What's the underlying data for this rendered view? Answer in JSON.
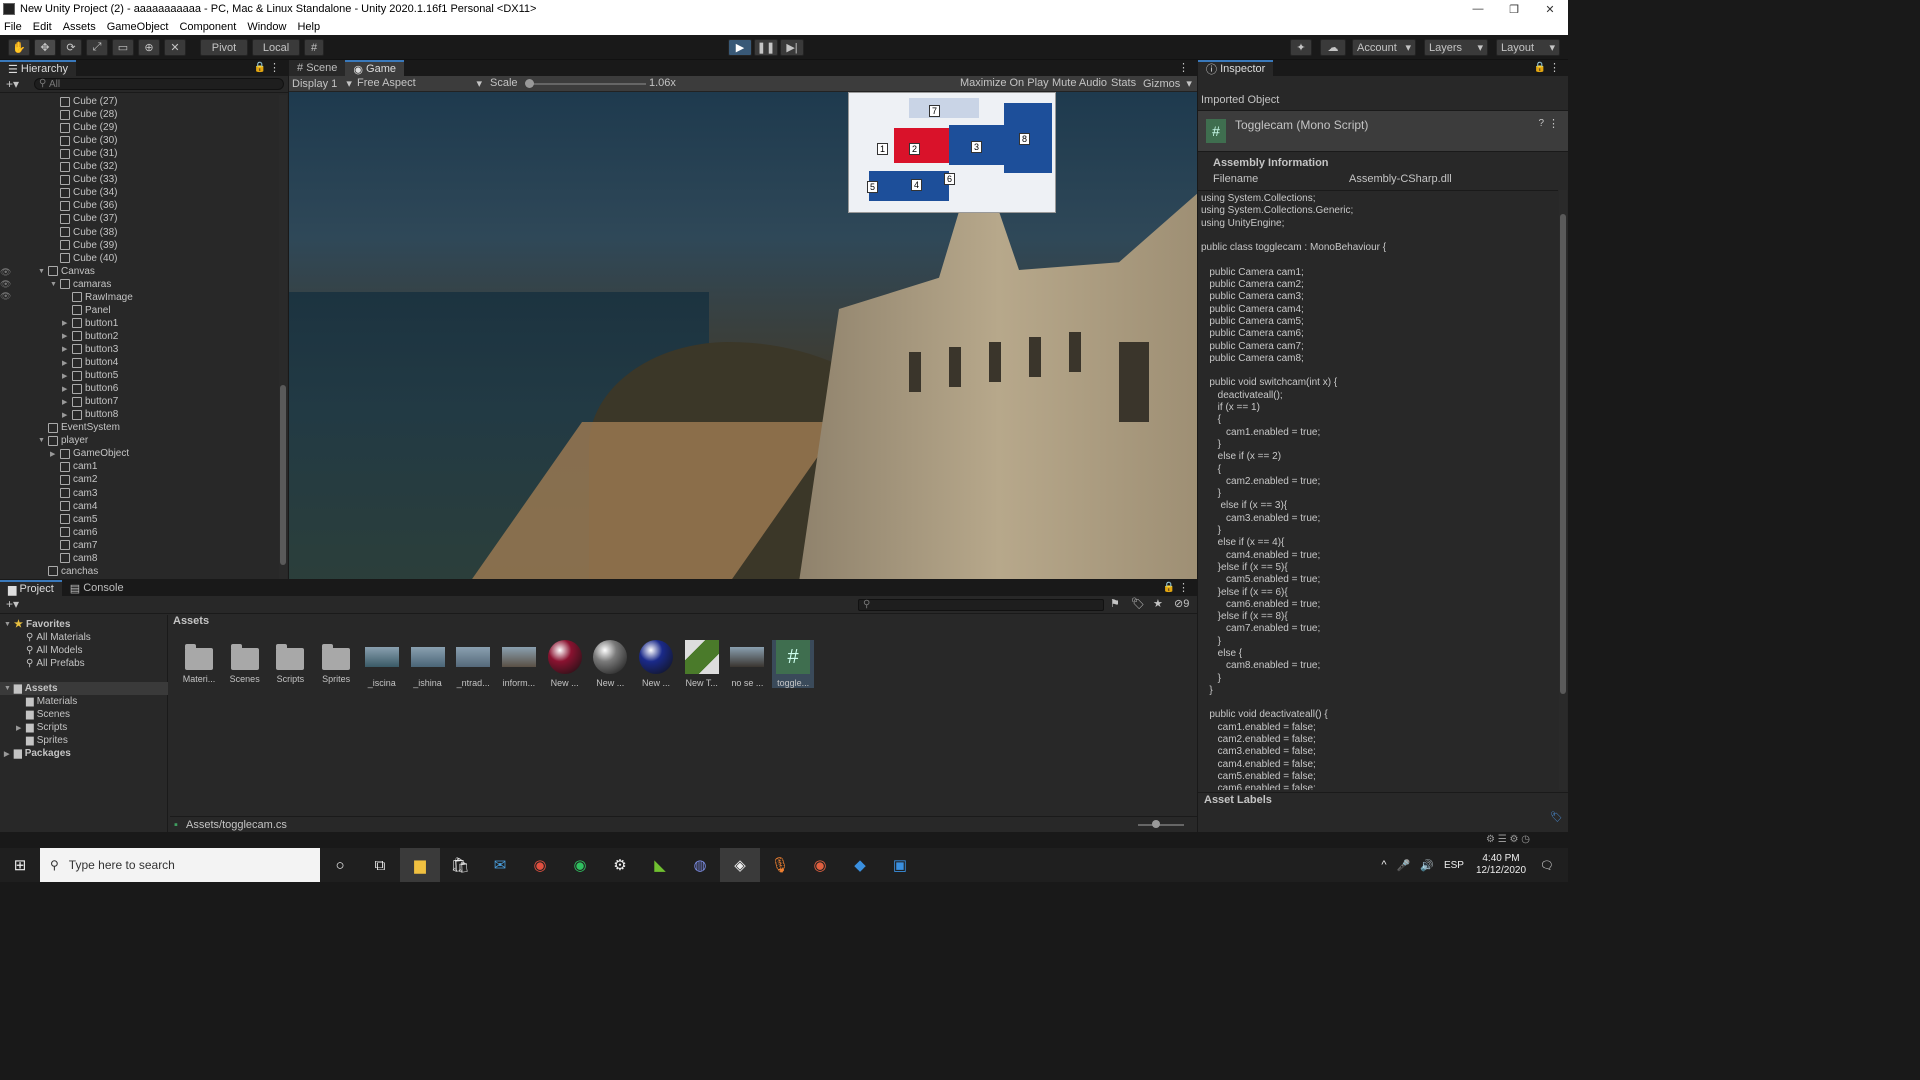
{
  "window": {
    "title": "New Unity Project (2) - aaaaaaaaaaa - PC, Mac & Linux Standalone - Unity 2020.1.16f1 Personal <DX11>"
  },
  "menu": [
    "File",
    "Edit",
    "Assets",
    "GameObject",
    "Component",
    "Window",
    "Help"
  ],
  "toolbar": {
    "pivot": "Pivot",
    "local": "Local",
    "account": "Account",
    "layers": "Layers",
    "layout": "Layout"
  },
  "hierarchy": {
    "tab": "Hierarchy",
    "search_placeholder": "All",
    "rows": [
      {
        "label": "Cube (27)",
        "indent": 2,
        "arrow": ""
      },
      {
        "label": "Cube (28)",
        "indent": 2,
        "arrow": ""
      },
      {
        "label": "Cube (29)",
        "indent": 2,
        "arrow": ""
      },
      {
        "label": "Cube (30)",
        "indent": 2,
        "arrow": ""
      },
      {
        "label": "Cube (31)",
        "indent": 2,
        "arrow": ""
      },
      {
        "label": "Cube (32)",
        "indent": 2,
        "arrow": ""
      },
      {
        "label": "Cube (33)",
        "indent": 2,
        "arrow": ""
      },
      {
        "label": "Cube (34)",
        "indent": 2,
        "arrow": ""
      },
      {
        "label": "Cube (36)",
        "indent": 2,
        "arrow": ""
      },
      {
        "label": "Cube (37)",
        "indent": 2,
        "arrow": ""
      },
      {
        "label": "Cube (38)",
        "indent": 2,
        "arrow": ""
      },
      {
        "label": "Cube (39)",
        "indent": 2,
        "arrow": ""
      },
      {
        "label": "Cube (40)",
        "indent": 2,
        "arrow": ""
      },
      {
        "label": "Canvas",
        "indent": 1,
        "arrow": "▼"
      },
      {
        "label": "camaras",
        "indent": 2,
        "arrow": "▼"
      },
      {
        "label": "RawImage",
        "indent": 3,
        "arrow": ""
      },
      {
        "label": "Panel",
        "indent": 3,
        "arrow": ""
      },
      {
        "label": "button1",
        "indent": 3,
        "arrow": "▶"
      },
      {
        "label": "button2",
        "indent": 3,
        "arrow": "▶"
      },
      {
        "label": "button3",
        "indent": 3,
        "arrow": "▶"
      },
      {
        "label": "button4",
        "indent": 3,
        "arrow": "▶"
      },
      {
        "label": "button5",
        "indent": 3,
        "arrow": "▶"
      },
      {
        "label": "button6",
        "indent": 3,
        "arrow": "▶"
      },
      {
        "label": "button7",
        "indent": 3,
        "arrow": "▶"
      },
      {
        "label": "button8",
        "indent": 3,
        "arrow": "▶"
      },
      {
        "label": "EventSystem",
        "indent": 1,
        "arrow": ""
      },
      {
        "label": "player",
        "indent": 1,
        "arrow": "▼"
      },
      {
        "label": "GameObject",
        "indent": 2,
        "arrow": "▶"
      },
      {
        "label": "cam1",
        "indent": 2,
        "arrow": ""
      },
      {
        "label": "cam2",
        "indent": 2,
        "arrow": ""
      },
      {
        "label": "cam3",
        "indent": 2,
        "arrow": ""
      },
      {
        "label": "cam4",
        "indent": 2,
        "arrow": ""
      },
      {
        "label": "cam5",
        "indent": 2,
        "arrow": ""
      },
      {
        "label": "cam6",
        "indent": 2,
        "arrow": ""
      },
      {
        "label": "cam7",
        "indent": 2,
        "arrow": ""
      },
      {
        "label": "cam8",
        "indent": 2,
        "arrow": ""
      },
      {
        "label": "canchas",
        "indent": 1,
        "arrow": ""
      }
    ]
  },
  "scene_tabs": {
    "scene": "Scene",
    "game": "Game"
  },
  "game_bar": {
    "display": "Display 1",
    "aspect": "Free Aspect",
    "scale_label": "Scale",
    "scale_value": "1.06x",
    "maximize": "Maximize On Play",
    "mute": "Mute Audio",
    "stats": "Stats",
    "gizmos": "Gizmos"
  },
  "map_labels": [
    "1",
    "2",
    "3",
    "4",
    "5",
    "6",
    "7",
    "8"
  ],
  "inspector": {
    "tab": "Inspector",
    "imported": "Imported Object",
    "object_name": "Togglecam (Mono Script)",
    "assembly_header": "Assembly Information",
    "filename_label": "Filename",
    "filename_value": "Assembly-CSharp.dll",
    "code": "using System.Collections;\nusing System.Collections.Generic;\nusing UnityEngine;\n\npublic class togglecam : MonoBehaviour {\n\n   public Camera cam1;\n   public Camera cam2;\n   public Camera cam3;\n   public Camera cam4;\n   public Camera cam5;\n   public Camera cam6;\n   public Camera cam7;\n   public Camera cam8;\n\n   public void switchcam(int x) {\n      deactivateall();\n      if (x == 1)\n      {\n         cam1.enabled = true;\n      }\n      else if (x == 2)\n      {\n         cam2.enabled = true;\n      }\n       else if (x == 3){\n         cam3.enabled = true;\n      }\n      else if (x == 4){\n         cam4.enabled = true;\n      }else if (x == 5){\n         cam5.enabled = true;\n      }else if (x == 6){\n         cam6.enabled = true;\n      }else if (x == 8){\n         cam7.enabled = true;\n      }\n      else {\n         cam8.enabled = true;\n      }\n   }\n\n   public void deactivateall() {\n      cam1.enabled = false;\n      cam2.enabled = false;\n      cam3.enabled = false;\n      cam4.enabled = false;\n      cam5.enabled = false;\n      cam6.enabled = false;",
    "asset_labels": "Asset Labels"
  },
  "project": {
    "tab": "Project",
    "console_tab": "Console",
    "hidden_count": "9",
    "favorites": "Favorites",
    "fav_items": [
      "All Materials",
      "All Models",
      "All Prefabs"
    ],
    "assets_root": "Assets",
    "asset_folders": [
      "Materials",
      "Scenes",
      "Scripts",
      "Sprites"
    ],
    "packages": "Packages",
    "breadcrumb": "Assets",
    "path": "Assets/togglecam.cs",
    "items": [
      {
        "label": "Materi...",
        "kind": "folder",
        "color": ""
      },
      {
        "label": "Scenes",
        "kind": "folder",
        "color": ""
      },
      {
        "label": "Scripts",
        "kind": "folder",
        "color": ""
      },
      {
        "label": "Sprites",
        "kind": "folder",
        "color": ""
      },
      {
        "label": "_iscina",
        "kind": "image",
        "color": "#3a5a66"
      },
      {
        "label": "_ishina",
        "kind": "image",
        "color": "#4a6577"
      },
      {
        "label": "_ntrad...",
        "kind": "image",
        "color": "#55697a"
      },
      {
        "label": "inform...",
        "kind": "image",
        "color": "#5a5045"
      },
      {
        "label": "New ...",
        "kind": "sphere",
        "color": "#8a1230"
      },
      {
        "label": "New ...",
        "kind": "sphere",
        "color": "#7a7a7a"
      },
      {
        "label": "New ...",
        "kind": "sphere",
        "color": "#1a2a8a"
      },
      {
        "label": "New T...",
        "kind": "terrain",
        "color": "#4a7a2a"
      },
      {
        "label": "no se ...",
        "kind": "image",
        "color": "#3a3530"
      },
      {
        "label": "toggle...",
        "kind": "script",
        "color": "#3f6e4f"
      }
    ]
  },
  "taskbar": {
    "search_placeholder": "Type here to search",
    "lang": "ESP",
    "time": "4:40 PM",
    "date": "12/12/2020"
  }
}
